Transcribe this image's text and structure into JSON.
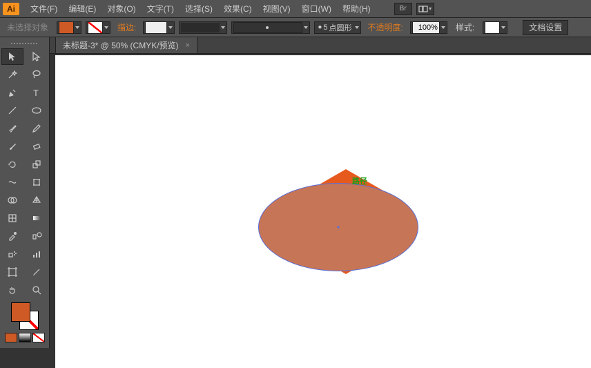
{
  "app_logo": "Ai",
  "menu": [
    "文件(F)",
    "编辑(E)",
    "对象(O)",
    "文字(T)",
    "选择(S)",
    "效果(C)",
    "视图(V)",
    "窗口(W)",
    "帮助(H)"
  ],
  "hdr_btn_br": "Br",
  "ctrl": {
    "no_sel": "未选择对象",
    "stroke_label": "描边:",
    "stroke_weight": "",
    "brush_size": "5",
    "brush_text": "点圆形",
    "opacity_label": "不透明度:",
    "opacity": "100%",
    "style_label": "样式:",
    "doc_setup": "文档设置"
  },
  "tab": {
    "title": "未标题-3* @ 50% (CMYK/预览)",
    "close": "×"
  },
  "canvas": {
    "path_label": "路径"
  },
  "colors": {
    "fill": "#d05a26",
    "ellipse_fill": "#c67556",
    "ellipse_stroke": "#5a6fd8",
    "hex_fill": "#e75a1e"
  }
}
